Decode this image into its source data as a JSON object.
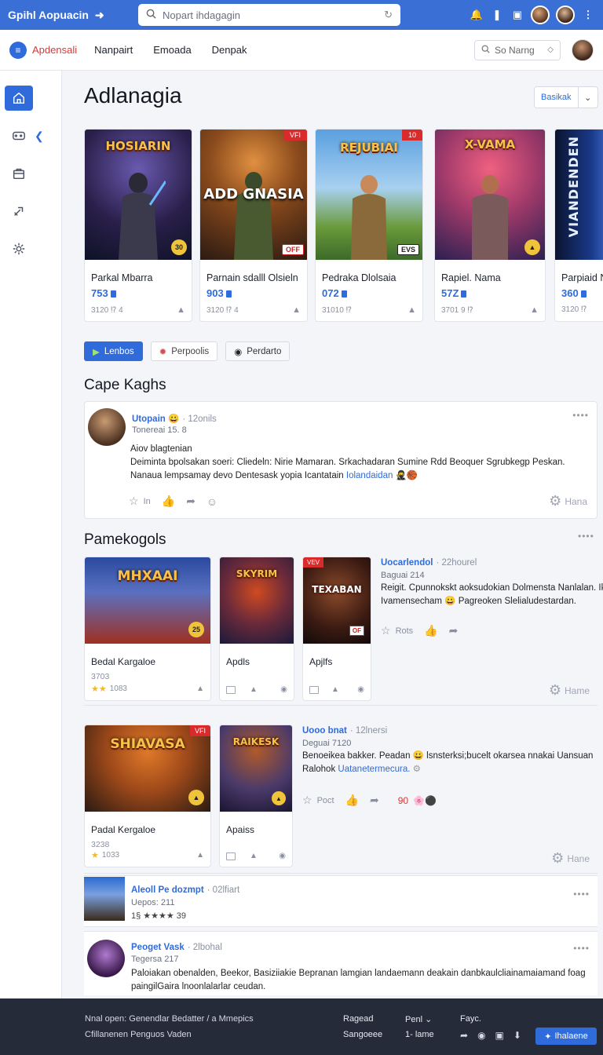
{
  "topbar": {
    "app_title": "Gpihl Aopuacin",
    "search_placeholder": "Nopart ihdagagin"
  },
  "nav": {
    "brand": "Apdensali",
    "links": [
      "Nanpairt",
      "Emoada",
      "Denpak"
    ],
    "search_placeholder": "So Narng"
  },
  "page": {
    "title": "Adlanagia",
    "sort_label": "Basikak"
  },
  "games": [
    {
      "art_title": "HOSIARIN",
      "name": "Parkal Mbarra",
      "price": "753",
      "meta": "3120 ⁉ 4",
      "badge": "30",
      "colors": [
        "#3b2a5e",
        "#1a2a4a"
      ]
    },
    {
      "art_title": "ADD GNASIA",
      "name": "Parnain sdalll Olsieln",
      "price": "903",
      "meta": "3120 ⁉ 4",
      "tag": "OFF",
      "corner": "VFI",
      "colors": [
        "#8a4a1c",
        "#2b1a12"
      ]
    },
    {
      "art_title": "REJUBIAI",
      "name": "Pedraka Dlolsaia",
      "price": "072",
      "meta": "31010 ⁉",
      "tag": "EVS",
      "corner": "10",
      "colors": [
        "#4a8ac8",
        "#3c6a2a"
      ]
    },
    {
      "art_title": "X-VAMA",
      "name": "Rapiel. Nama",
      "price": "57Z",
      "meta": "3701 9 ⁉",
      "badge": "▲",
      "colors": [
        "#d14a6a",
        "#2a2050"
      ]
    },
    {
      "art_title": "VIANDENDEN",
      "name": "Parpiaid N",
      "price": "360",
      "meta": "3120 ⁉",
      "colors": [
        "#1a3a8a",
        "#0a1430"
      ]
    }
  ],
  "filters": [
    "Lenbos",
    "Perpoolis",
    "Perdarto"
  ],
  "sections": {
    "cape": "Cape Kaghs",
    "pamek": "Pamekogols"
  },
  "post1": {
    "user": "Utopain 😀",
    "time": "· 12onils",
    "sub": "Tonereai 15. 8",
    "line1": "Aiov blagtenian",
    "line2": "Deiminta bpolsakan soeri: Cliedeln: Nirie Mamaran. Srkachadaran Sumine Rdd Beoquer Sgrubkegp Peskan.",
    "line3": "Nanaua lempsamay devo Dentesask yopia Icantatain ",
    "line3_link": "Iolandaidan",
    "line3_emoji": "🥷🏀",
    "action_label": "In",
    "share_label": "Hana"
  },
  "group1": {
    "cards": [
      {
        "art_title": "MHXAAI",
        "name": "Bedal Kargaloe",
        "sub": "3703",
        "rating": "1083",
        "colors": [
          "#2a4aa0",
          "#a03020"
        ]
      },
      {
        "art_title": "SKYRIM",
        "name": "Apdls",
        "colors": [
          "#3a2a6a",
          "#d04a20"
        ]
      },
      {
        "art_title": "TEXABAN",
        "name": "Apjlfs",
        "corner": "VEV",
        "tag": "OF",
        "colors": [
          "#5a2a1a",
          "#1a1012"
        ]
      }
    ],
    "user": "Uocarlendol",
    "time": "· 22hourel",
    "sub": "Baguai 214",
    "line1": "Reigit. Cpunnokskt aoksudokian Dolmensta Nanlalan. Ik",
    "line2": "Ivamensecham 😀 Pagreoken Slelialudestardan.",
    "action_label": "Rots",
    "share_label": "Hame"
  },
  "group2": {
    "cards": [
      {
        "art_title": "SHIAVASA",
        "name": "Padal Kergaloe",
        "sub": "3238",
        "rating": "1033",
        "corner": "VFI",
        "colors": [
          "#a04a1a",
          "#2a1a12"
        ]
      },
      {
        "art_title": "RAIKESK",
        "name": "Apaiss",
        "colors": [
          "#4a3a6a",
          "#b05a2a"
        ]
      }
    ],
    "user": "Uooo bnat",
    "time": "· 12lnersi",
    "sub": "Deguai 7120",
    "line1": "Benoeikea bakker. Peadan 😀 lsnsterksi;bucelt okarsea nnakai Uansuan",
    "line2": "Ralohok ",
    "line2_link": "Uatanetermecura.",
    "action_label": "Poct",
    "count": "90",
    "share_label": "Hane"
  },
  "item1": {
    "user": "Aleoll Pe dozmpt",
    "time": "· 02lfiart",
    "sub": "Uepos: 211",
    "rating": "1§ ★★★★ 39"
  },
  "item2": {
    "user": "Peoget Vask",
    "time": "· 2lbohal",
    "sub": "Tegersa 217",
    "line1": "Paloiakan obenalden, Beekor, Basiziiakie Bepranan lamgian landaemann deakain danbkaulcliainamaiamand foag",
    "line2": "paingilGaira lnoonlalarlar ceudan."
  },
  "footer": {
    "line1": "Nnal open: Genendlar Bedatter / a Mmepics",
    "line2": "Cfillanenen Penguos Vaden",
    "col1": [
      "Ragead",
      "Sangoeee"
    ],
    "col2": [
      "Penl ⌄",
      "1- lame"
    ],
    "col3": "Fayc.",
    "button": "Ihalaene"
  }
}
